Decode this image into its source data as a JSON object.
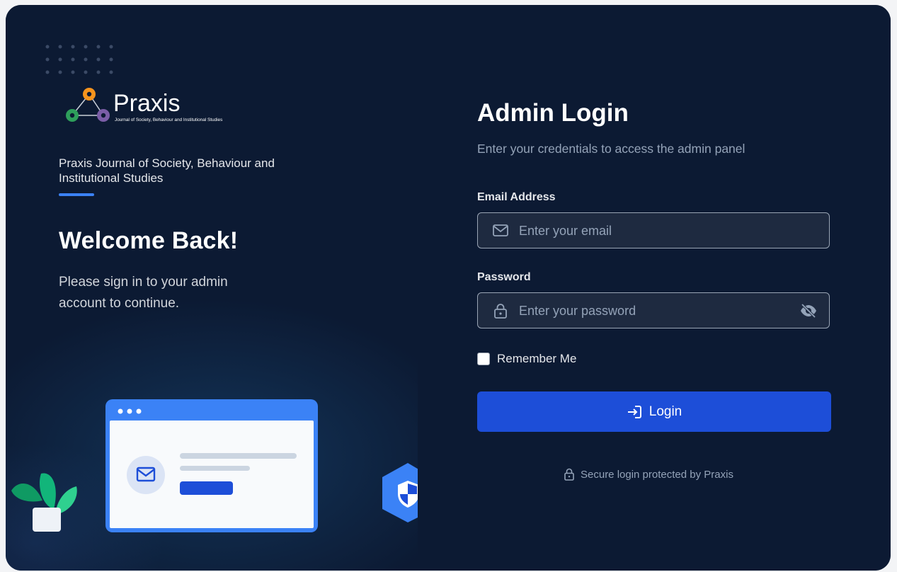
{
  "brand": {
    "name": "Praxis",
    "tagline": "Journal of Society, Behaviour and Institutional Studies",
    "colors": {
      "orange": "#f7941d",
      "green": "#2e9e5b",
      "purple": "#7b5ea7"
    }
  },
  "left_panel": {
    "journal_title": "Praxis Journal of Society, Behaviour and Institutional Studies",
    "welcome_heading": "Welcome Back!",
    "welcome_text": "Please sign in to your admin account to continue."
  },
  "login": {
    "title": "Admin Login",
    "subtitle": "Enter your credentials to access the admin panel",
    "email": {
      "label": "Email Address",
      "placeholder": "Enter your email",
      "value": "",
      "icon": "mail-icon"
    },
    "password": {
      "label": "Password",
      "placeholder": "Enter your password",
      "value": "",
      "icon": "lock-icon",
      "toggle_icon": "eye-off-icon"
    },
    "remember_label": "Remember Me",
    "remember_checked": false,
    "button_label": "Login",
    "button_icon": "login-icon",
    "secure_text": "Secure login protected by Praxis",
    "accent": "#1d4ed8"
  }
}
